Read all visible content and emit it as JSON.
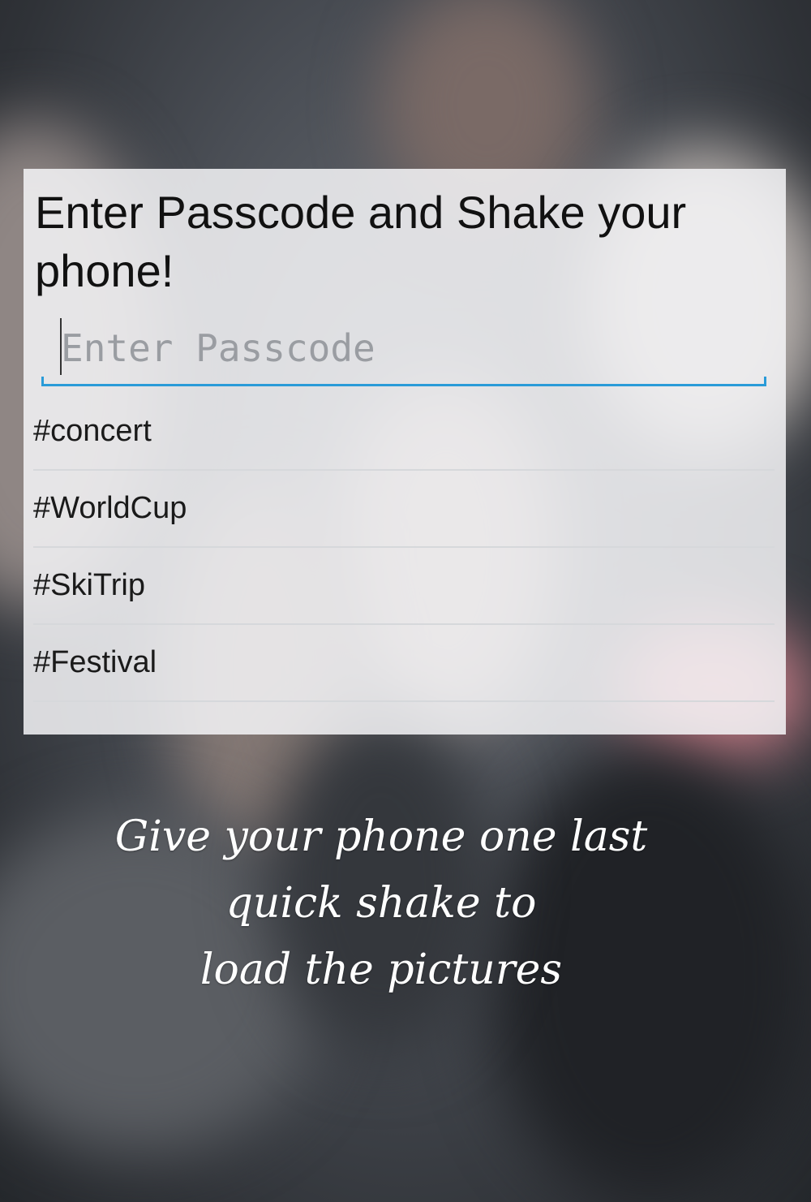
{
  "dialog": {
    "title": "Enter Passcode and Shake your phone!",
    "passcode": {
      "value": "",
      "placeholder": "Enter Passcode"
    },
    "hashtags": [
      {
        "label": "#concert"
      },
      {
        "label": "#WorldCup"
      },
      {
        "label": "#SkiTrip"
      },
      {
        "label": "#Festival"
      }
    ]
  },
  "instructions": {
    "lines": [
      "Give your phone one last",
      "quick shake to",
      "load the pictures"
    ]
  },
  "colors": {
    "accent": "#2a9bd8",
    "card_background": "#f4f4f7",
    "divider": "#d6d8db"
  }
}
